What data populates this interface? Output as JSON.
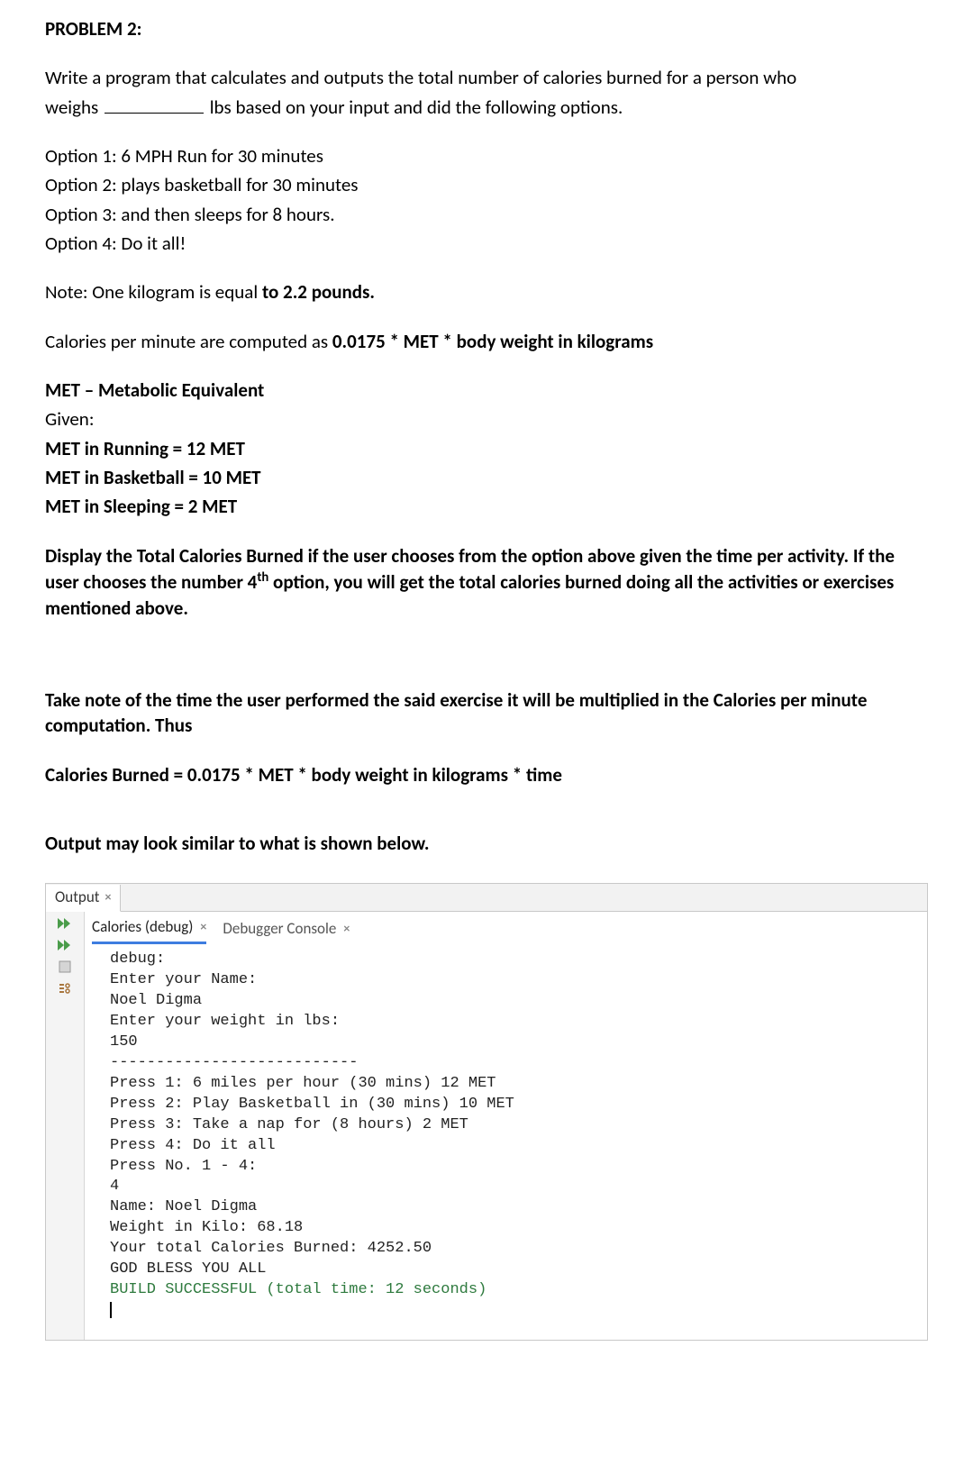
{
  "title": "PROBLEM 2:",
  "intro": {
    "line1a": "Write a program that calculates and outputs the total number of calories burned for a person who",
    "line1b_prefix": "weighs ",
    "line1b_suffix": " lbs based on your input and did the following options."
  },
  "options": [
    "Option 1: 6 MPH Run for 30 minutes",
    "Option 2: plays basketball for 30 minutes",
    "Option 3: and then sleeps for 8 hours.",
    "Option 4: Do it all!"
  ],
  "note_prefix": "Note: One kilogram is equal ",
  "note_bold": "to 2.2 pounds.",
  "cpm_prefix": "Calories per minute are computed as ",
  "cpm_bold": "0.0175 * MET * body weight in kilograms",
  "met_heading": "MET – Metabolic Equivalent",
  "given": "Given:",
  "mets": [
    "MET in Running = 12 MET",
    "MET in Basketball = 10 MET",
    "MET in Sleeping = 2 MET"
  ],
  "display_text_1": "Display the Total Calories Burned if the user chooses from the option above given the time per activity. If the user chooses the number 4",
  "display_text_th": "th",
  "display_text_2": " option, you will get the total calories burned doing all the activities or exercises mentioned above.",
  "take_note": "Take note of the time the user performed the said exercise it will be multiplied in the Calories per minute computation. Thus",
  "formula": "Calories Burned = 0.0175 * MET * body weight in kilograms * time",
  "output_similar": "Output may look similar to what is shown below.",
  "panel": {
    "output_tab": "Output",
    "calories_tab": "Calories (debug)",
    "debugger_tab": "Debugger Console"
  },
  "console": {
    "lines": [
      "debug:",
      "Enter your Name:",
      "Noel Digma",
      "Enter your weight in lbs:",
      "150",
      "---------------------------",
      "Press 1: 6 miles per hour (30 mins) 12 MET",
      "Press 2: Play Basketball in (30 mins) 10 MET",
      "Press 3: Take a nap for (8 hours) 2 MET",
      "Press 4: Do it all",
      "Press No. 1 - 4:",
      "4",
      "Name: Noel Digma",
      "Weight in Kilo: 68.18",
      "Your total Calories Burned: 4252.50",
      "GOD BLESS YOU ALL"
    ],
    "build": "BUILD SUCCESSFUL (total time: 12 seconds)"
  }
}
